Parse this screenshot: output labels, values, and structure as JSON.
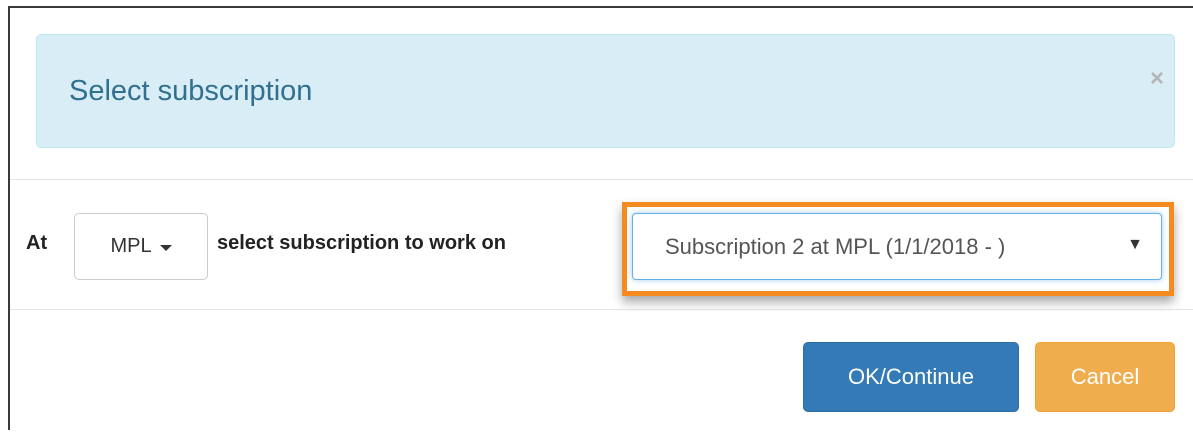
{
  "header": {
    "title": "Select subscription",
    "close_icon": "close-icon"
  },
  "form": {
    "at_label": "At",
    "location_dropdown": "MPL",
    "select_label": "select subscription to work on",
    "subscription_value": "Subscription 2 at MPL (1/1/2018 - )",
    "subscription_arrow": "▼"
  },
  "footer": {
    "ok_label": "OK/Continue",
    "cancel_label": "Cancel"
  },
  "colors": {
    "alert_bg": "#d9edf7",
    "alert_text": "#31708f",
    "primary": "#337ab7",
    "warning": "#f0ad4e",
    "highlight": "#f58a1f"
  }
}
